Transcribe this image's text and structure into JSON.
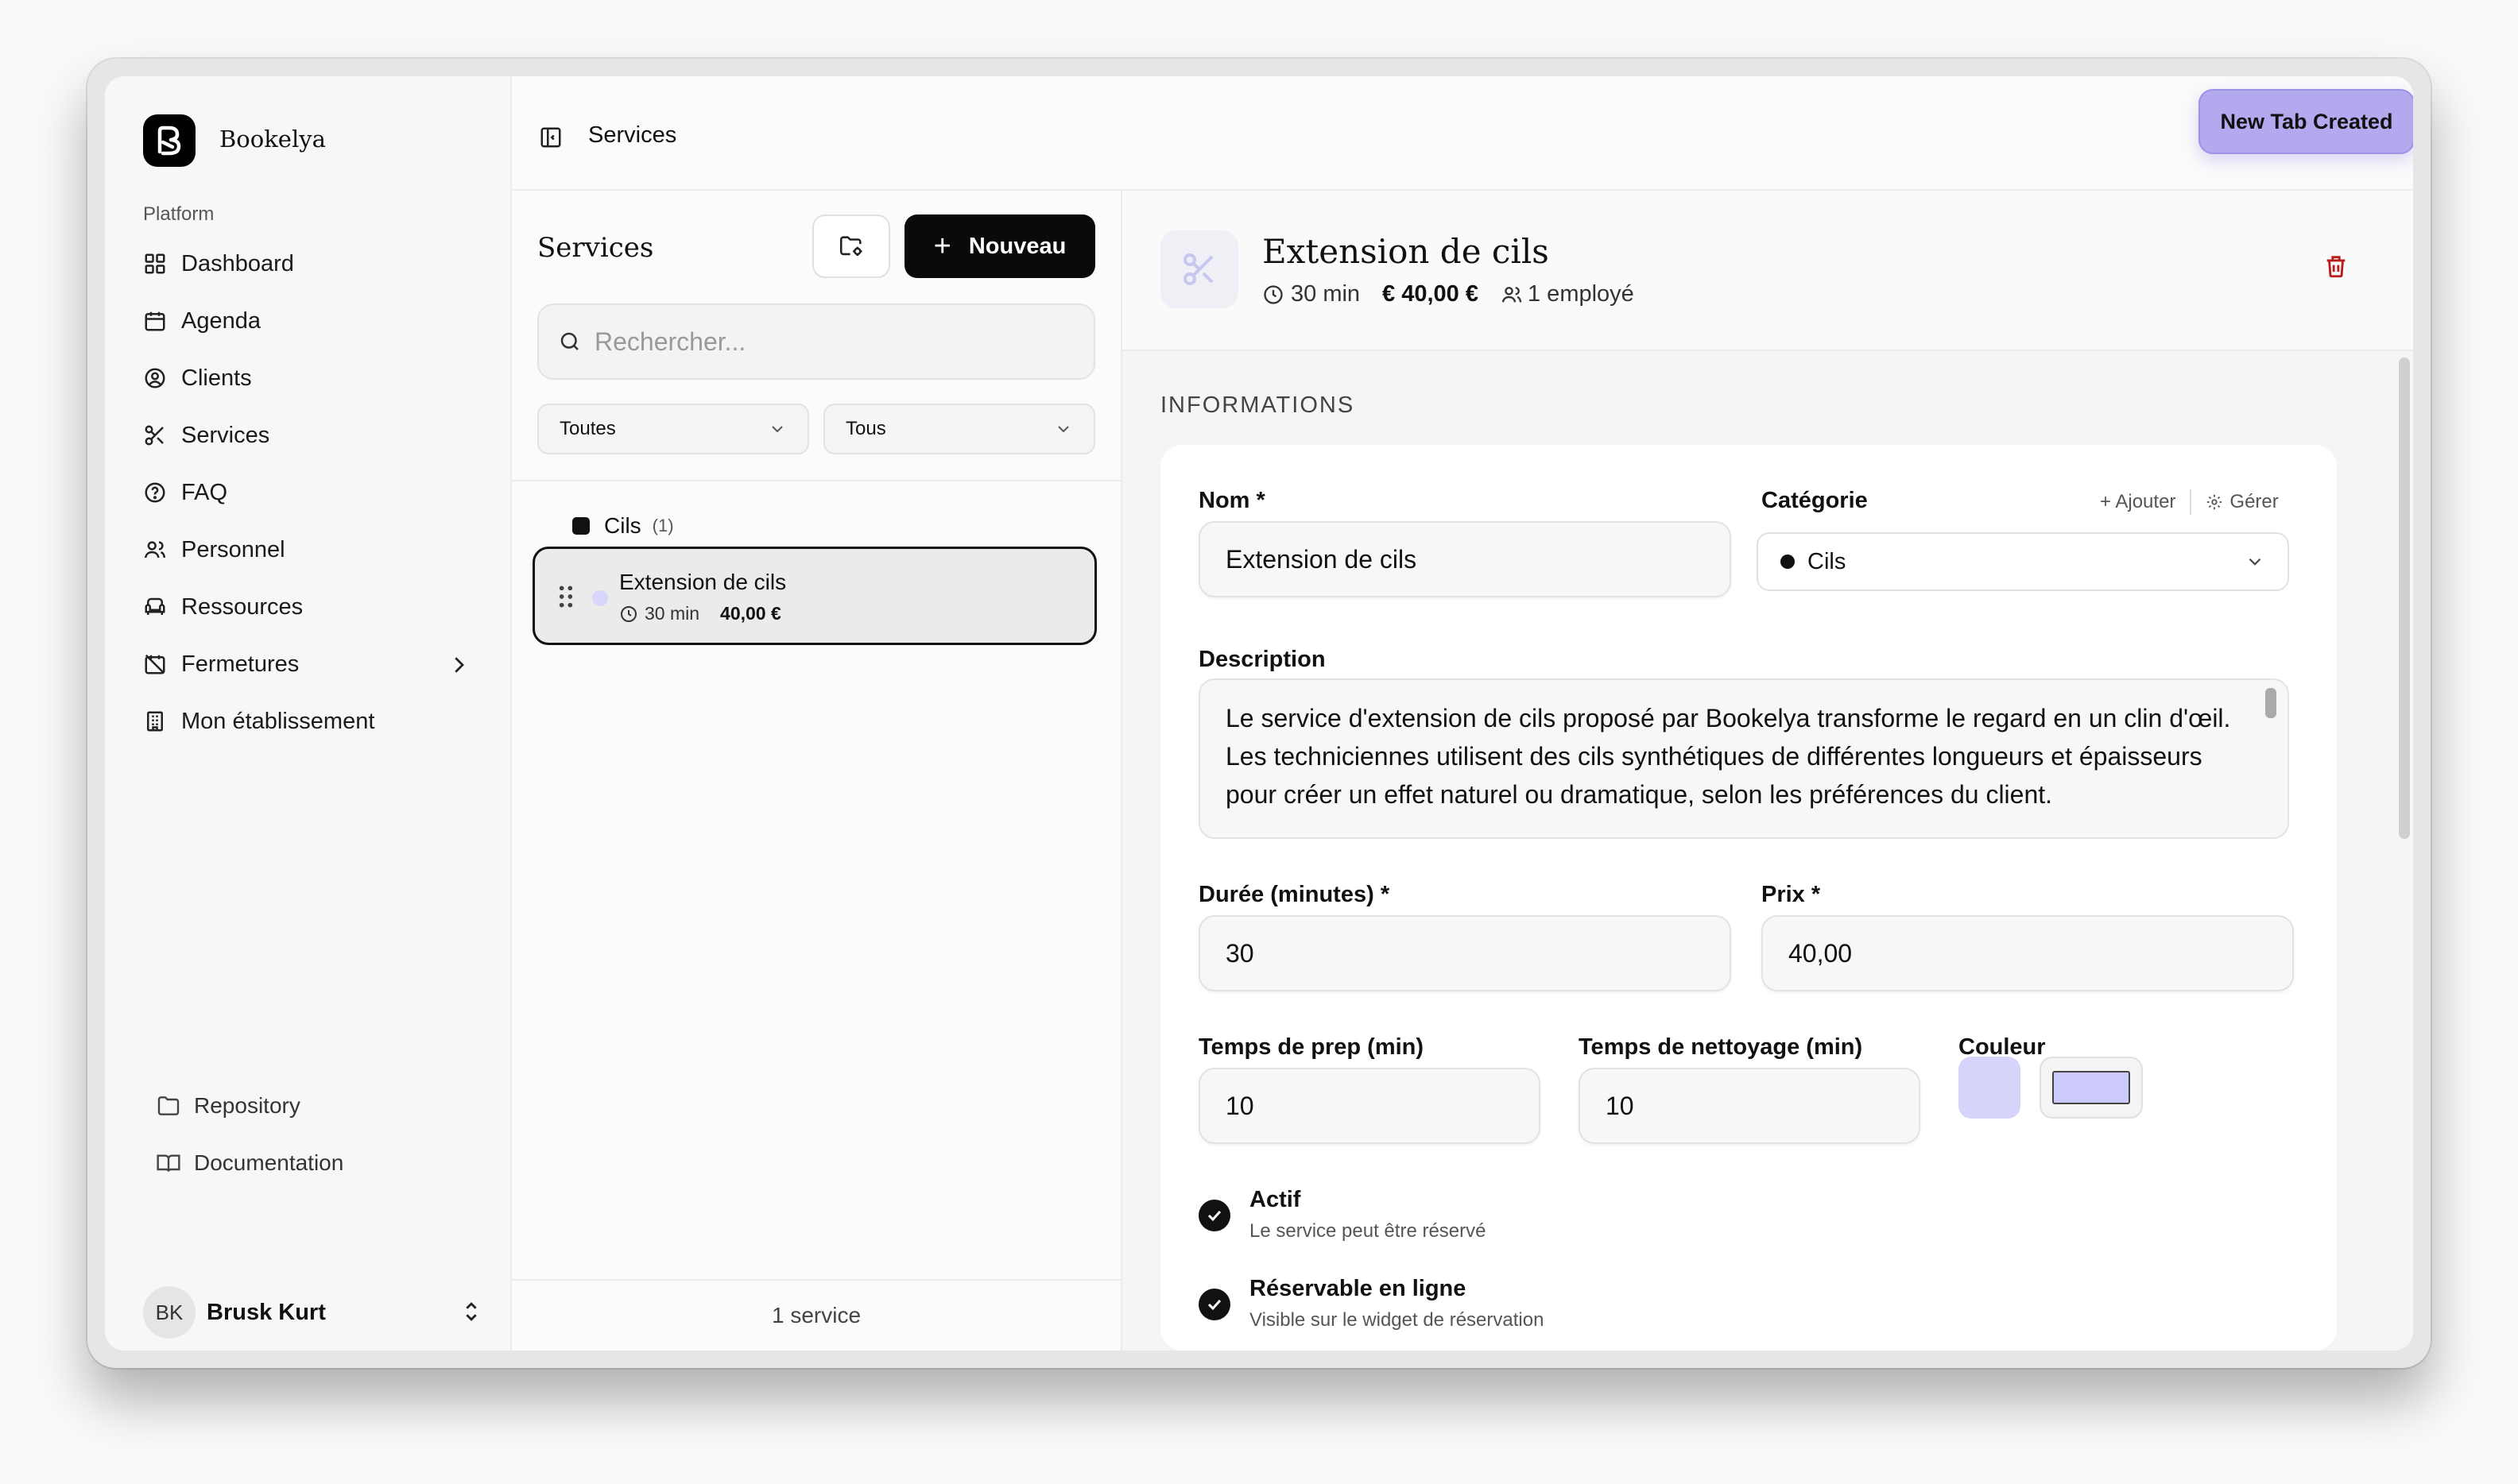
{
  "app": {
    "brand": "Bookelya",
    "top_title": "Services",
    "toast": "New Tab Created"
  },
  "sidebar": {
    "section": "Platform",
    "items": [
      {
        "label": "Dashboard",
        "icon": "grid-icon"
      },
      {
        "label": "Agenda",
        "icon": "calendar-icon"
      },
      {
        "label": "Clients",
        "icon": "user-circle-icon"
      },
      {
        "label": "Services",
        "icon": "scissors-icon"
      },
      {
        "label": "FAQ",
        "icon": "help-circle-icon"
      },
      {
        "label": "Personnel",
        "icon": "users-icon"
      },
      {
        "label": "Ressources",
        "icon": "armchair-icon"
      },
      {
        "label": "Fermetures",
        "icon": "calendar-off-icon"
      },
      {
        "label": "Mon établissement",
        "icon": "building-icon"
      }
    ],
    "bottom": {
      "repository": "Repository",
      "documentation": "Documentation"
    },
    "user": {
      "initials": "BK",
      "name": "Brusk Kurt"
    }
  },
  "list": {
    "title": "Services",
    "new_label": "Nouveau",
    "search_placeholder": "Rechercher...",
    "filter_category": "Toutes",
    "filter_status": "Tous",
    "group": {
      "name": "Cils",
      "count": "(1)"
    },
    "service": {
      "name": "Extension de cils",
      "duration": "30 min",
      "price": "40,00 €"
    },
    "footer": "1 service"
  },
  "detail": {
    "title": "Extension de cils",
    "duration": "30 min",
    "price": "€ 40,00 €",
    "employees": "1 employé",
    "section": "INFORMATIONS",
    "fields": {
      "name_label": "Nom *",
      "name_value": "Extension de cils",
      "category_label": "Catégorie",
      "category_add": "+ Ajouter",
      "category_manage": "Gérer",
      "category_value": "Cils",
      "description_label": "Description",
      "description_value": "Le service d'extension de cils proposé par Bookelya transforme le regard en un clin d'œil. Les techniciennes utilisent des cils synthétiques de différentes longueurs et épaisseurs pour créer un effet naturel ou dramatique, selon les préférences du client.",
      "duration_label": "Durée (minutes) *",
      "duration_value": "30",
      "price_label": "Prix *",
      "price_value": "40,00",
      "prep_label": "Temps de prep (min)",
      "prep_value": "10",
      "cleanup_label": "Temps de nettoyage (min)",
      "cleanup_value": "10",
      "color_label": "Couleur",
      "color_value": "#d6d4fb"
    },
    "toggles": [
      {
        "title": "Actif",
        "subtitle": "Le service peut être réservé"
      },
      {
        "title": "Réservable en ligne",
        "subtitle": "Visible sur le widget de réservation"
      }
    ]
  }
}
